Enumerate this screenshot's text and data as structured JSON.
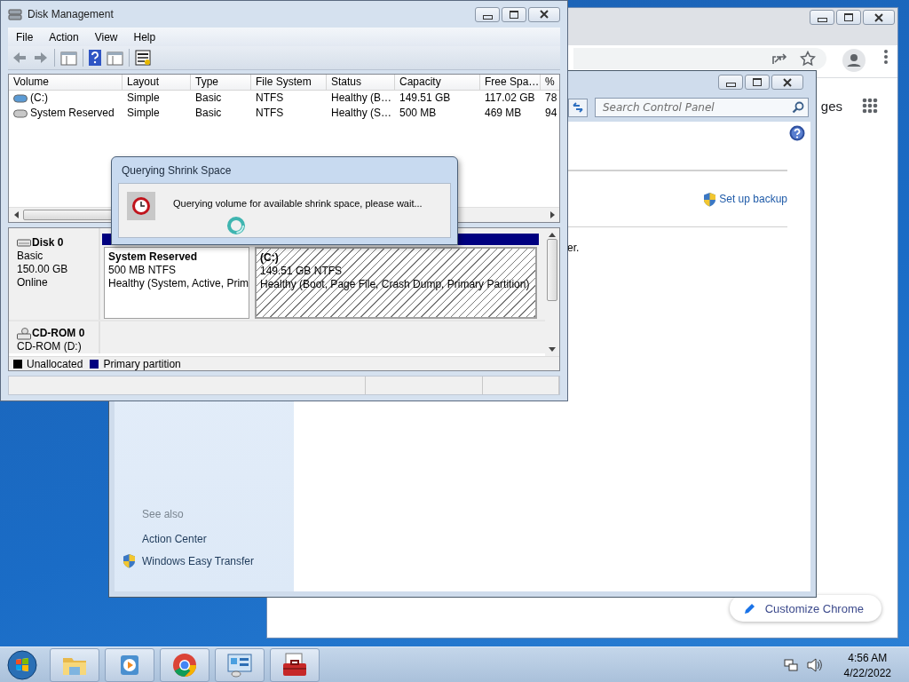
{
  "chrome": {
    "partial_text": "ges",
    "customize_button": "Customize Chrome"
  },
  "control_panel": {
    "search": {
      "placeholder": "Search Control Panel"
    },
    "link": "Set up backup",
    "text_fragment": "er.",
    "see_also": {
      "heading": "See also",
      "items": [
        {
          "label": "Action Center",
          "shield": false
        },
        {
          "label": "Windows Easy Transfer",
          "shield": true
        }
      ]
    }
  },
  "disk_management": {
    "title": "Disk Management",
    "menu": [
      "File",
      "Action",
      "View",
      "Help"
    ],
    "volume_table": {
      "columns": [
        "Volume",
        "Layout",
        "Type",
        "File System",
        "Status",
        "Capacity",
        "Free Spa…",
        "%"
      ],
      "rows": [
        {
          "color": "#5b9bd5",
          "cells": [
            "(C:)",
            "Simple",
            "Basic",
            "NTFS",
            "Healthy (B…",
            "149.51 GB",
            "117.02 GB",
            "78"
          ]
        },
        {
          "color": "#c8c8c8",
          "cells": [
            "System Reserved",
            "Simple",
            "Basic",
            "NTFS",
            "Healthy (S…",
            "500 MB",
            "469 MB",
            "94"
          ]
        }
      ]
    },
    "disks": [
      {
        "name": "Disk 0",
        "type": "Basic",
        "size": "150.00 GB",
        "status": "Online",
        "partitions": [
          {
            "name": "System Reserved",
            "size": "500 MB NTFS",
            "status": "Healthy (System, Active, Prim",
            "selected": false
          },
          {
            "name": "(C:)",
            "size": "149.51 GB NTFS",
            "status": "Healthy (Boot, Page File, Crash Dump, Primary Partition)",
            "selected": true
          }
        ]
      }
    ],
    "cdrom": {
      "name": "CD-ROM 0",
      "drive": "CD-ROM (D:)"
    },
    "legend": [
      {
        "label": "Unallocated",
        "color": "#000000"
      },
      {
        "label": "Primary partition",
        "color": "#000080"
      }
    ]
  },
  "dialog": {
    "title": "Querying Shrink Space",
    "message": "Querying volume for available shrink space, please wait..."
  },
  "taskbar": {
    "apps": [
      {
        "kind": "explorer"
      },
      {
        "kind": "media"
      },
      {
        "kind": "browser"
      },
      {
        "kind": "control"
      },
      {
        "kind": "toolbox"
      }
    ],
    "time": "4:56 AM",
    "date": "4/22/2022"
  }
}
